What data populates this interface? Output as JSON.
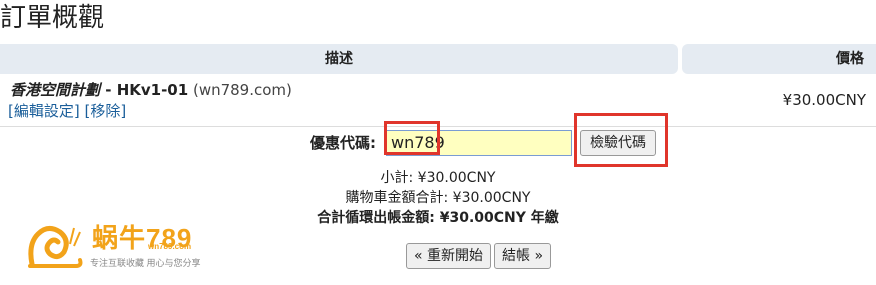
{
  "page": {
    "title": "訂單概觀"
  },
  "table": {
    "headers": {
      "description": "描述",
      "price": "價格"
    },
    "rows": [
      {
        "group": "香港空間計劃",
        "separator": " - ",
        "product": "HKv1-01",
        "domain": "(wn789.com)",
        "edit_label": "[編輯設定]",
        "remove_label": "[移除]",
        "price": "¥30.00CNY"
      }
    ]
  },
  "promo": {
    "label": "優惠代碼:",
    "value": "wn789",
    "validate_label": "檢驗代碼"
  },
  "totals": {
    "subtotal": "小計: ¥30.00CNY",
    "cart_total": "購物車金額合計: ¥30.00CNY",
    "recurring": "合計循環出帳金額: ¥30.00CNY 年繳"
  },
  "buttons": {
    "restart": "« 重新開始",
    "checkout": "結帳 »"
  },
  "watermark": {
    "brand": "蜗牛789",
    "url": "wn789.com",
    "tagline": "专注互联收藏  用心与您分享"
  },
  "colors": {
    "header_bg": "#e5ebf2",
    "link": "#1a5e9a",
    "promo_bg": "#ffffc0",
    "highlight": "#e0352b",
    "brand": "#f2a31a"
  }
}
